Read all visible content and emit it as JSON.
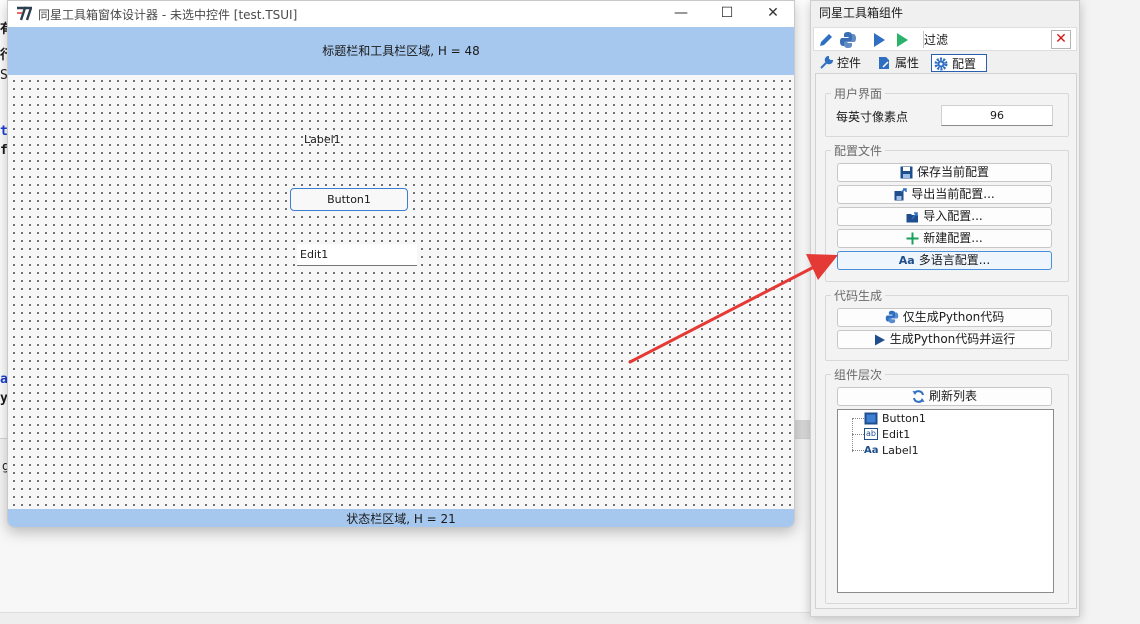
{
  "background": {
    "code_chars": [
      "有",
      "行",
      "S",
      "t",
      "f",
      "a",
      "y",
      "g"
    ]
  },
  "designer": {
    "window_title": "同星工具箱窗体设计器 - 未选中控件 [test.TSUI]",
    "header_text": "标题栏和工具栏区域, H = 48",
    "status_text": "状态栏区域, H = 21",
    "label_widget": "Label1",
    "button_widget": "Button1",
    "edit_widget": "Edit1",
    "window_controls": {
      "minimize": "—",
      "maximize": "☐",
      "close": "✕"
    }
  },
  "panel": {
    "title": "同星工具箱组件",
    "toolbar": {
      "filter_label": "过滤",
      "close_glyph": "✕"
    },
    "tabs": [
      {
        "label": "控件",
        "active": false
      },
      {
        "label": "属性",
        "active": false
      },
      {
        "label": "配置",
        "active": true
      }
    ],
    "ui_group": {
      "title": "用户界面",
      "dpi_label": "每英寸像素点",
      "dpi_value": "96"
    },
    "config_group": {
      "title": "配置文件",
      "buttons": [
        {
          "label": "保存当前配置",
          "icon": "save-icon"
        },
        {
          "label": "导出当前配置...",
          "icon": "export-icon"
        },
        {
          "label": "导入配置...",
          "icon": "import-icon"
        },
        {
          "label": "新建配置...",
          "icon": "plus-icon"
        },
        {
          "label": "多语言配置...",
          "icon": "language-icon",
          "prefix": "Aa"
        }
      ]
    },
    "codegen_group": {
      "title": "代码生成",
      "buttons": [
        {
          "label": "仅生成Python代码",
          "icon": "python-icon"
        },
        {
          "label": "生成Python代码并运行",
          "icon": "run-icon"
        }
      ]
    },
    "hierarchy_group": {
      "title": "组件层次",
      "refresh_label": "刷新列表",
      "tree": [
        {
          "label": "Button1",
          "icon": "button-icon"
        },
        {
          "label": "Edit1",
          "icon": "edit-icon",
          "badge": "ab"
        },
        {
          "label": "Label1",
          "icon": "label-icon",
          "badge": "Aa"
        }
      ]
    }
  },
  "colors": {
    "designer_bar": "#a6c8ef",
    "arrow": "#e53935",
    "accent": "#2a5fb0"
  }
}
